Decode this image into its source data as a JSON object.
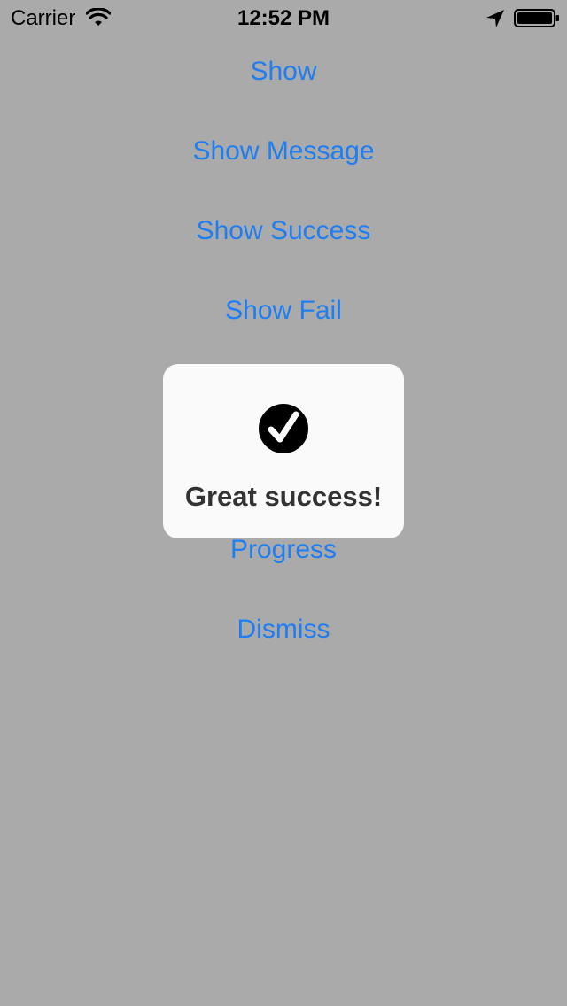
{
  "status_bar": {
    "carrier": "Carrier",
    "time": "12:52 PM",
    "icons": [
      "wifi-icon",
      "location-arrow-icon",
      "battery-icon"
    ]
  },
  "menu": {
    "items": [
      {
        "label": "Show"
      },
      {
        "label": "Show Message"
      },
      {
        "label": "Show Success"
      },
      {
        "label": "Show Fail"
      },
      {
        "label": "Progress"
      },
      {
        "label": "Dismiss"
      }
    ]
  },
  "hud": {
    "icon": "checkmark-circle-icon",
    "message": "Great success!"
  },
  "colors": {
    "background": "#aaaaaa",
    "accent": "#1e7ef2",
    "hud_background": "#fdfdfd",
    "hud_text": "#333333"
  }
}
